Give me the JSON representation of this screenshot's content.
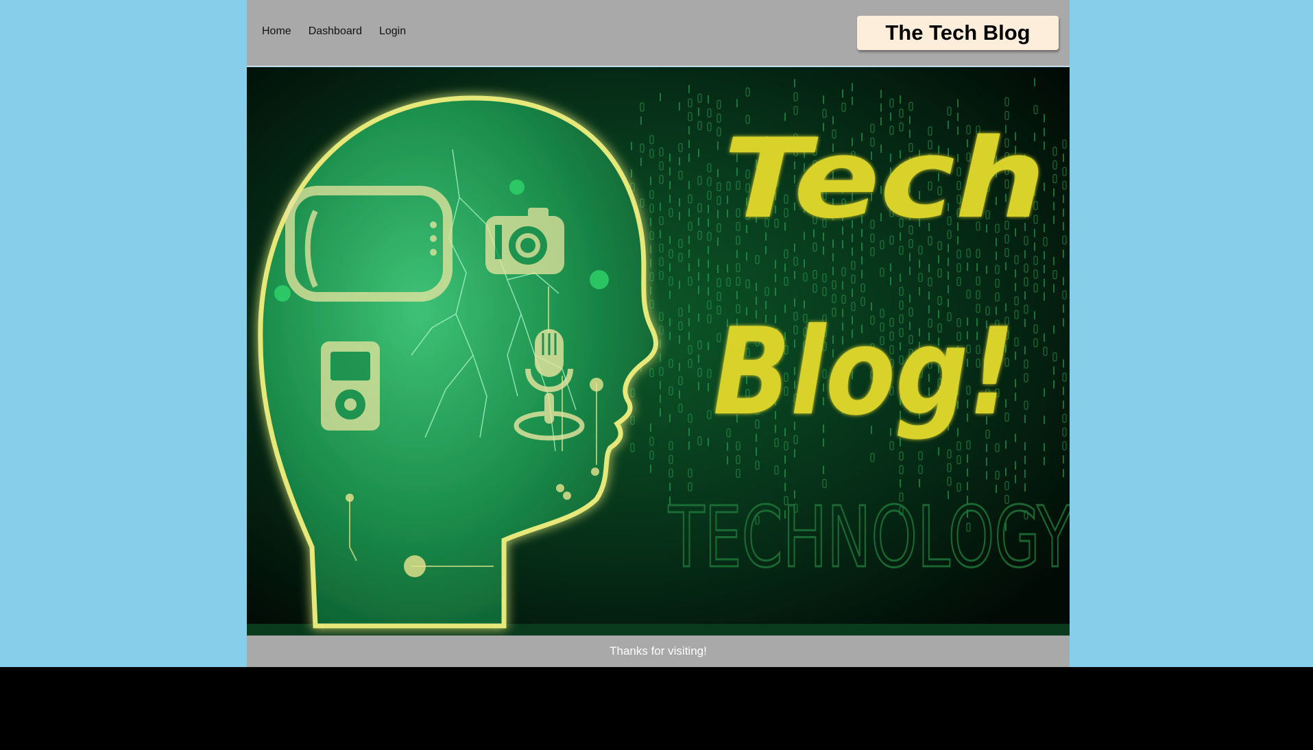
{
  "nav": {
    "items": [
      {
        "label": "Home"
      },
      {
        "label": "Dashboard"
      },
      {
        "label": "Login"
      }
    ]
  },
  "header": {
    "title": "The Tech Blog"
  },
  "hero": {
    "image_text_line1": "Tech",
    "image_text_line2": "Blog!",
    "image_text_background": "TECHNOLOGY",
    "icons": [
      "tv-icon",
      "camera-icon",
      "microphone-icon",
      "music-player-icon"
    ]
  },
  "footer": {
    "text": "Thanks for visiting!"
  },
  "colors": {
    "page_background": "#87ceeb",
    "header_background": "#a9a9a9",
    "brand_background": "#fdeedc",
    "footer_background": "#a9a9a9",
    "hero_text": "#d9d22c",
    "hero_glow": "#2fd46a"
  }
}
